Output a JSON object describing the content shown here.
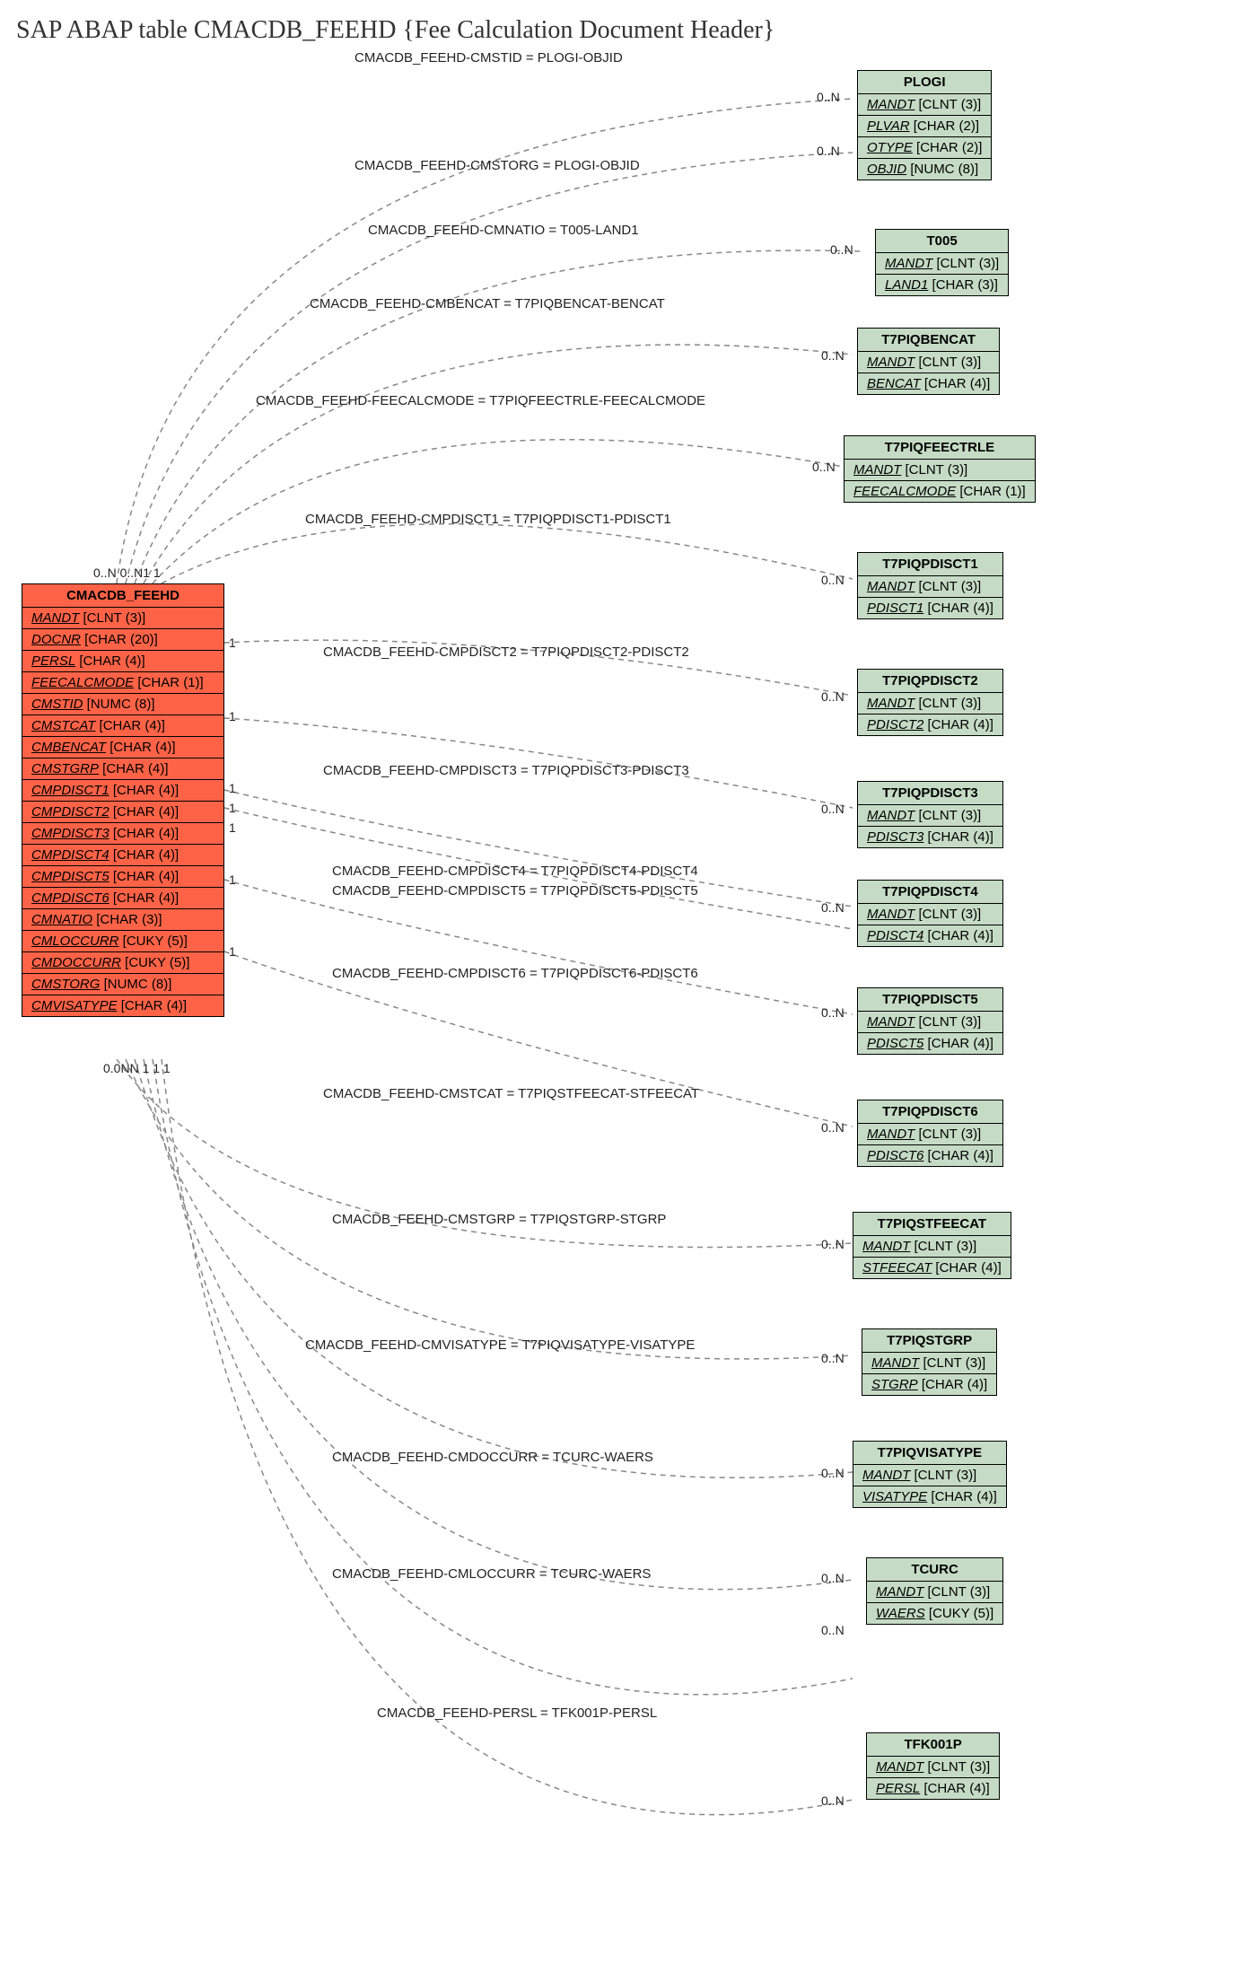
{
  "title": "SAP ABAP table CMACDB_FEEHD {Fee Calculation Document Header}",
  "main_entity": {
    "name": "CMACDB_FEEHD",
    "fields": [
      {
        "name": "MANDT",
        "type": "[CLNT (3)]"
      },
      {
        "name": "DOCNR",
        "type": "[CHAR (20)]"
      },
      {
        "name": "PERSL",
        "type": "[CHAR (4)]"
      },
      {
        "name": "FEECALCMODE",
        "type": "[CHAR (1)]"
      },
      {
        "name": "CMSTID",
        "type": "[NUMC (8)]"
      },
      {
        "name": "CMSTCAT",
        "type": "[CHAR (4)]"
      },
      {
        "name": "CMBENCAT",
        "type": "[CHAR (4)]"
      },
      {
        "name": "CMSTGRP",
        "type": "[CHAR (4)]"
      },
      {
        "name": "CMPDISCT1",
        "type": "[CHAR (4)]"
      },
      {
        "name": "CMPDISCT2",
        "type": "[CHAR (4)]"
      },
      {
        "name": "CMPDISCT3",
        "type": "[CHAR (4)]"
      },
      {
        "name": "CMPDISCT4",
        "type": "[CHAR (4)]"
      },
      {
        "name": "CMPDISCT5",
        "type": "[CHAR (4)]"
      },
      {
        "name": "CMPDISCT6",
        "type": "[CHAR (4)]"
      },
      {
        "name": "CMNATIO",
        "type": "[CHAR (3)]"
      },
      {
        "name": "CMLOCCURR",
        "type": "[CUKY (5)]"
      },
      {
        "name": "CMDOCCURR",
        "type": "[CUKY (5)]"
      },
      {
        "name": "CMSTORG",
        "type": "[NUMC (8)]"
      },
      {
        "name": "CMVISATYPE",
        "type": "[CHAR (4)]"
      }
    ]
  },
  "ref_entities": [
    {
      "name": "PLOGI",
      "fields": [
        {
          "name": "MANDT",
          "type": "[CLNT (3)]"
        },
        {
          "name": "PLVAR",
          "type": "[CHAR (2)]"
        },
        {
          "name": "OTYPE",
          "type": "[CHAR (2)]"
        },
        {
          "name": "OBJID",
          "type": "[NUMC (8)]"
        }
      ]
    },
    {
      "name": "T005",
      "fields": [
        {
          "name": "MANDT",
          "type": "[CLNT (3)]"
        },
        {
          "name": "LAND1",
          "type": "[CHAR (3)]"
        }
      ]
    },
    {
      "name": "T7PIQBENCAT",
      "fields": [
        {
          "name": "MANDT",
          "type": "[CLNT (3)]"
        },
        {
          "name": "BENCAT",
          "type": "[CHAR (4)]"
        }
      ]
    },
    {
      "name": "T7PIQFEECTRLE",
      "fields": [
        {
          "name": "MANDT",
          "type": "[CLNT (3)]"
        },
        {
          "name": "FEECALCMODE",
          "type": "[CHAR (1)]"
        }
      ]
    },
    {
      "name": "T7PIQPDISCT1",
      "fields": [
        {
          "name": "MANDT",
          "type": "[CLNT (3)]"
        },
        {
          "name": "PDISCT1",
          "type": "[CHAR (4)]"
        }
      ]
    },
    {
      "name": "T7PIQPDISCT2",
      "fields": [
        {
          "name": "MANDT",
          "type": "[CLNT (3)]"
        },
        {
          "name": "PDISCT2",
          "type": "[CHAR (4)]"
        }
      ]
    },
    {
      "name": "T7PIQPDISCT3",
      "fields": [
        {
          "name": "MANDT",
          "type": "[CLNT (3)]"
        },
        {
          "name": "PDISCT3",
          "type": "[CHAR (4)]"
        }
      ]
    },
    {
      "name": "T7PIQPDISCT4",
      "fields": [
        {
          "name": "MANDT",
          "type": "[CLNT (3)]"
        },
        {
          "name": "PDISCT4",
          "type": "[CHAR (4)]"
        }
      ]
    },
    {
      "name": "T7PIQPDISCT5",
      "fields": [
        {
          "name": "MANDT",
          "type": "[CLNT (3)]"
        },
        {
          "name": "PDISCT5",
          "type": "[CHAR (4)]"
        }
      ]
    },
    {
      "name": "T7PIQPDISCT6",
      "fields": [
        {
          "name": "MANDT",
          "type": "[CLNT (3)]"
        },
        {
          "name": "PDISCT6",
          "type": "[CHAR (4)]"
        }
      ]
    },
    {
      "name": "T7PIQSTFEECAT",
      "fields": [
        {
          "name": "MANDT",
          "type": "[CLNT (3)]"
        },
        {
          "name": "STFEECAT",
          "type": "[CHAR (4)]"
        }
      ]
    },
    {
      "name": "T7PIQSTGRP",
      "fields": [
        {
          "name": "MANDT",
          "type": "[CLNT (3)]"
        },
        {
          "name": "STGRP",
          "type": "[CHAR (4)]"
        }
      ]
    },
    {
      "name": "T7PIQVISATYPE",
      "fields": [
        {
          "name": "MANDT",
          "type": "[CLNT (3)]"
        },
        {
          "name": "VISATYPE",
          "type": "[CHAR (4)]"
        }
      ]
    },
    {
      "name": "TCURC",
      "fields": [
        {
          "name": "MANDT",
          "type": "[CLNT (3)]"
        },
        {
          "name": "WAERS",
          "type": "[CUKY (5)]"
        }
      ]
    },
    {
      "name": "TFK001P",
      "fields": [
        {
          "name": "MANDT",
          "type": "[CLNT (3)]"
        },
        {
          "name": "PERSL",
          "type": "[CHAR (4)]"
        }
      ]
    }
  ],
  "relations": [
    {
      "label": "CMACDB_FEEHD-CMSTID = PLOGI-OBJID"
    },
    {
      "label": "CMACDB_FEEHD-CMSTORG = PLOGI-OBJID"
    },
    {
      "label": "CMACDB_FEEHD-CMNATIO = T005-LAND1"
    },
    {
      "label": "CMACDB_FEEHD-CMBENCAT = T7PIQBENCAT-BENCAT"
    },
    {
      "label": "CMACDB_FEEHD-FEECALCMODE = T7PIQFEECTRLE-FEECALCMODE"
    },
    {
      "label": "CMACDB_FEEHD-CMPDISCT1 = T7PIQPDISCT1-PDISCT1"
    },
    {
      "label": "CMACDB_FEEHD-CMPDISCT2 = T7PIQPDISCT2-PDISCT2"
    },
    {
      "label": "CMACDB_FEEHD-CMPDISCT3 = T7PIQPDISCT3-PDISCT3"
    },
    {
      "label": "CMACDB_FEEHD-CMPDISCT4 = T7PIQPDISCT4-PDISCT4"
    },
    {
      "label": "CMACDB_FEEHD-CMPDISCT5 = T7PIQPDISCT5-PDISCT5"
    },
    {
      "label": "CMACDB_FEEHD-CMPDISCT6 = T7PIQPDISCT6-PDISCT6"
    },
    {
      "label": "CMACDB_FEEHD-CMSTCAT = T7PIQSTFEECAT-STFEECAT"
    },
    {
      "label": "CMACDB_FEEHD-CMSTGRP = T7PIQSTGRP-STGRP"
    },
    {
      "label": "CMACDB_FEEHD-CMVISATYPE = T7PIQVISATYPE-VISATYPE"
    },
    {
      "label": "CMACDB_FEEHD-CMDOCCURR = TCURC-WAERS"
    },
    {
      "label": "CMACDB_FEEHD-CMLOCCURR = TCURC-WAERS"
    },
    {
      "label": "CMACDB_FEEHD-PERSL = TFK001P-PERSL"
    }
  ],
  "cards": {
    "zero_n": "0..N",
    "one": "1",
    "main_top": "0..N 0..N1 1",
    "main_bot": "0.0NN 1 1 1"
  }
}
